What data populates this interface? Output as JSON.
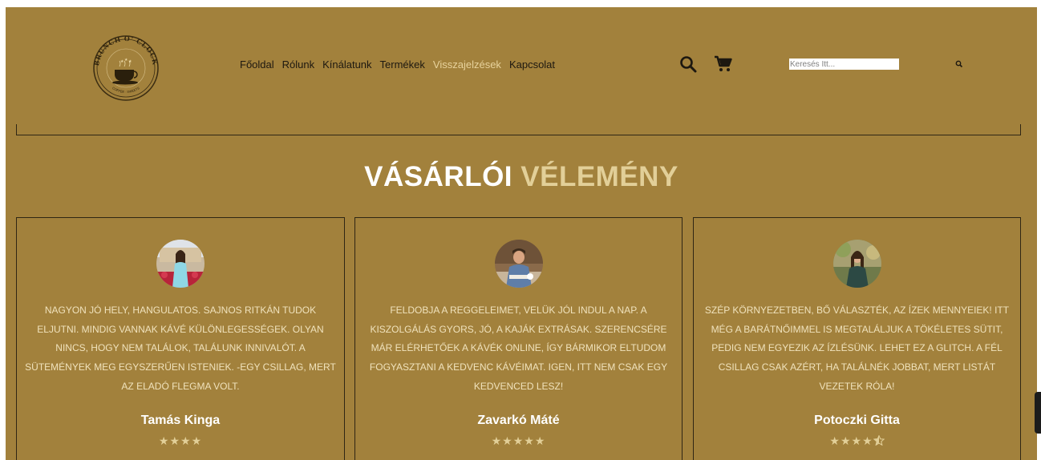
{
  "brand": {
    "logo_top_text": "BRUNCH O' CLOCK",
    "logo_bottom_text": "COFFEE · SWEETS"
  },
  "nav": {
    "items": [
      {
        "label": "Főoldal",
        "active": false
      },
      {
        "label": "Rólunk",
        "active": false
      },
      {
        "label": "Kínálatunk",
        "active": false
      },
      {
        "label": "Termékek",
        "active": false
      },
      {
        "label": "Visszajelzések",
        "active": true
      },
      {
        "label": "Kapcsolat",
        "active": false
      }
    ]
  },
  "header_icons": [
    "search-icon",
    "cart-icon"
  ],
  "search": {
    "placeholder": "Keresés Itt..."
  },
  "section": {
    "title_part1": "VÁSÁRLÓI",
    "title_part2": "VÉLEMÉNY"
  },
  "reviews": [
    {
      "text": "NAGYON JÓ HELY, HANGULATOS. SAJNOS RITKÁN TUDOK ELJUTNI. MINDIG VANNAK KÁVÉ KÜLÖNLEGESSÉGEK. OLYAN NINCS, HOGY NEM TALÁLOK, TALÁLUNK INNIVALÓT. A SÜTEMÉNYEK MEG EGYSZERŰEN ISTENIEK. -EGY CSILLAG, MERT AZ ELADÓ FLEGMA VOLT.",
      "name": "Tamás Kinga",
      "rating": 4
    },
    {
      "text": "FELDOBJA A REGGELEIMET, VELÜK JÓL INDUL A NAP. A KISZOLGÁLÁS GYORS, JÓ, A KAJÁK EXTRÁSAK. SZERENCSÉRE MÁR ELÉRHETŐEK A KÁVÉK ONLINE, ÍGY BÁRMIKOR ELTUDOM FOGYASZTANI A KEDVENC KÁVÉIMAT. IGEN, ITT NEM CSAK EGY KEDVENCED LESZ!",
      "name": "Zavarkó Máté",
      "rating": 5
    },
    {
      "text": "SZÉP KÖRNYEZETBEN, BŐ VÁLASZTÉK, AZ ÍZEK MENNYEIEK! ITT MÉG A BARÁTNŐIMMEL IS MEGTALÁLJUK A TÖKÉLETES SÜTIT, PEDIG NEM EGYEZIK AZ ÍZLÉSÜNK. LEHET EZ A GLITCH. A FÉL CSILLAG CSAK AZÉRT, HA TALÁLNÉK JOBBAT, MERT LISTÁT VEZETEK RÓLA!",
      "name": "Potoczki Gitta",
      "rating": 4.5
    }
  ],
  "colors": {
    "background": "#a2813c",
    "accent": "#e2cf98",
    "review_text": "#f0e2bc",
    "border": "#2f2614"
  }
}
